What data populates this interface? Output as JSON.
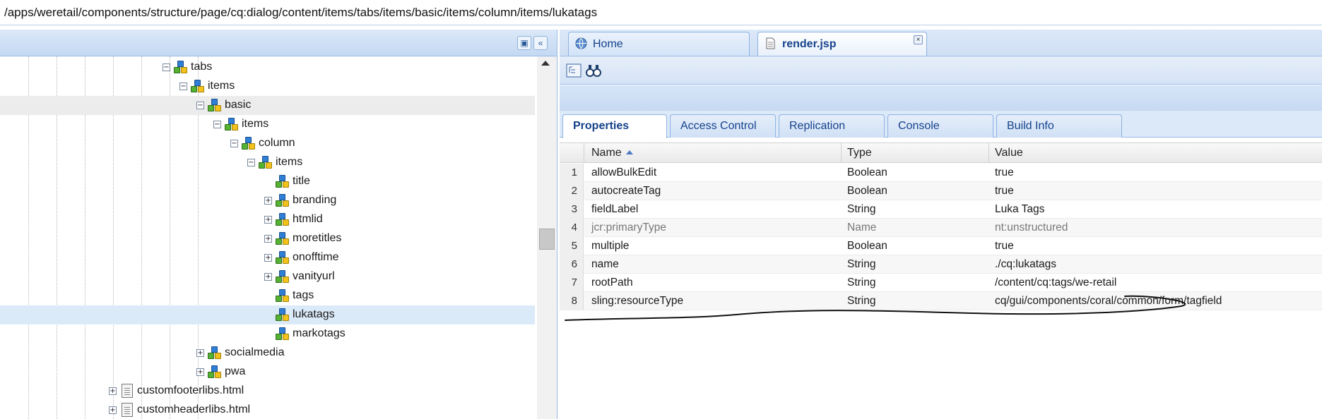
{
  "path": "/apps/weretail/components/structure/page/cq:dialog/content/items/tabs/items/basic/items/column/items/lukatags",
  "tree": {
    "nodes": [
      {
        "label": "tabs",
        "expander": "minus"
      },
      {
        "label": "items",
        "expander": "minus"
      },
      {
        "label": "basic",
        "expander": "minus"
      },
      {
        "label": "items",
        "expander": "minus"
      },
      {
        "label": "column",
        "expander": "minus"
      },
      {
        "label": "items",
        "expander": "minus"
      },
      {
        "label": "title",
        "expander": "none"
      },
      {
        "label": "branding",
        "expander": "plus"
      },
      {
        "label": "htmlid",
        "expander": "plus"
      },
      {
        "label": "moretitles",
        "expander": "plus"
      },
      {
        "label": "onofftime",
        "expander": "plus"
      },
      {
        "label": "vanityurl",
        "expander": "plus"
      },
      {
        "label": "tags",
        "expander": "none"
      },
      {
        "label": "lukatags",
        "expander": "none",
        "selected": true
      },
      {
        "label": "markotags",
        "expander": "none"
      },
      {
        "label": "socialmedia",
        "expander": "plus"
      },
      {
        "label": "pwa",
        "expander": "plus"
      },
      {
        "label": "customfooterlibs.html",
        "expander": "plus",
        "type": "file"
      },
      {
        "label": "customheaderlibs.html",
        "expander": "plus",
        "type": "file"
      }
    ]
  },
  "editor_tabs": [
    {
      "label": "Home",
      "icon": "globe-icon"
    },
    {
      "label": "render.jsp",
      "icon": "file-icon",
      "active": true,
      "closable": true
    }
  ],
  "toolbar": {
    "icons": [
      "tree-view-icon",
      "binoculars-icon"
    ]
  },
  "property_tabs": [
    {
      "label": "Properties",
      "active": true
    },
    {
      "label": "Access Control"
    },
    {
      "label": "Replication"
    },
    {
      "label": "Console"
    },
    {
      "label": "Build Info"
    }
  ],
  "grid": {
    "columns": {
      "name": "Name",
      "type": "Type",
      "value": "Value"
    },
    "sorted_by": "Name",
    "sort_dir": "asc",
    "rows": [
      {
        "n": "1",
        "name": "allowBulkEdit",
        "type": "Boolean",
        "value": "true"
      },
      {
        "n": "2",
        "name": "autocreateTag",
        "type": "Boolean",
        "value": "true"
      },
      {
        "n": "3",
        "name": "fieldLabel",
        "type": "String",
        "value": "Luka Tags"
      },
      {
        "n": "4",
        "name": "jcr:primaryType",
        "type": "Name",
        "value": "nt:unstructured",
        "protected": true
      },
      {
        "n": "5",
        "name": "multiple",
        "type": "Boolean",
        "value": "true"
      },
      {
        "n": "6",
        "name": "name",
        "type": "String",
        "value": "./cq:lukatags"
      },
      {
        "n": "7",
        "name": "rootPath",
        "type": "String",
        "value": "/content/cq:tags/we-retail"
      },
      {
        "n": "8",
        "name": "sling:resourceType",
        "type": "String",
        "value": "cq/gui/components/coral/common/form/tagfield"
      }
    ]
  },
  "colors": {
    "accent": "#15428b",
    "header_bg": "#c4d9f3",
    "selected_row": "#dbeaf9",
    "border": "#99bbe8"
  }
}
